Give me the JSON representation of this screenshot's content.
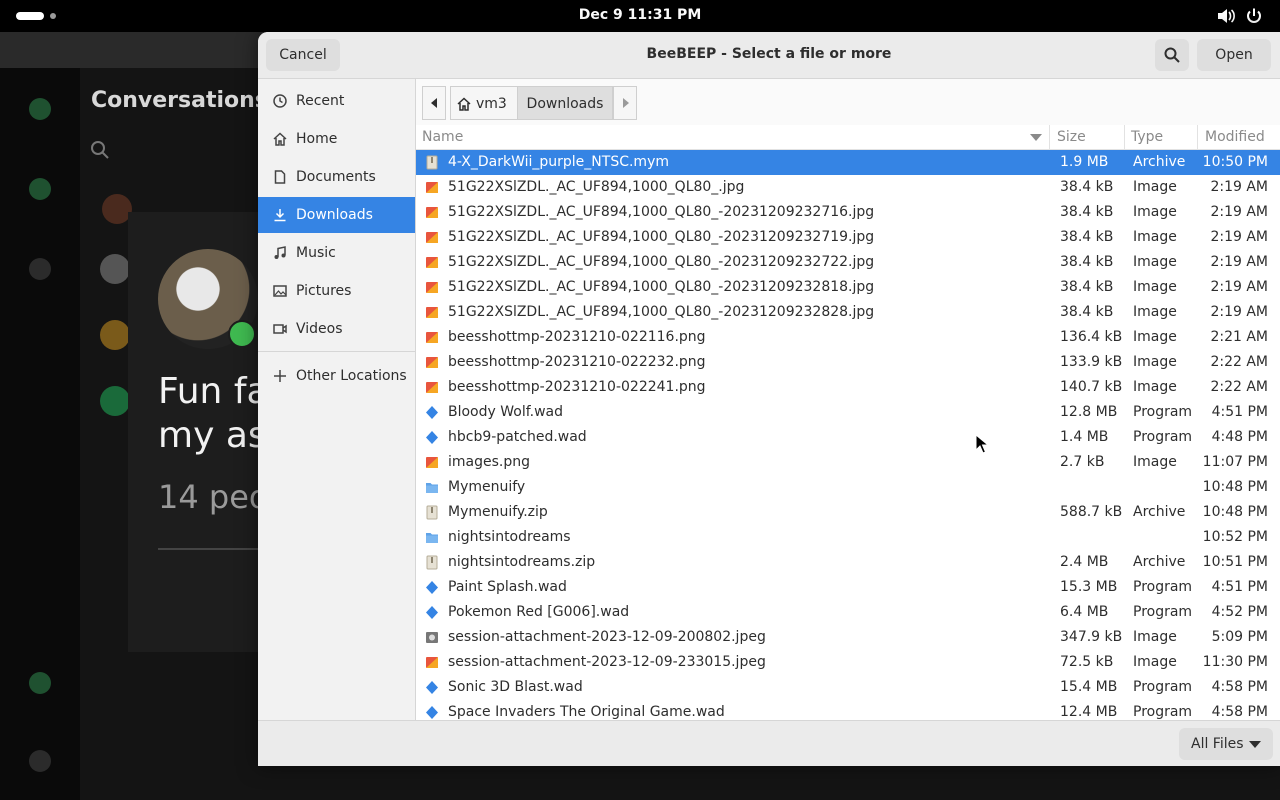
{
  "topbar": {
    "clock": "Dec 9  11:31 PM"
  },
  "background_app": {
    "title": "Conversations",
    "snippet_line1": "Fun fa",
    "snippet_line2": "my as",
    "snippet_count": "14 peo"
  },
  "dialog": {
    "title": "BeeBEEP - Select a file or more",
    "cancel_label": "Cancel",
    "open_label": "Open",
    "filter_label": "All Files"
  },
  "sidebar": {
    "items": [
      {
        "label": "Recent",
        "icon": "clock-icon"
      },
      {
        "label": "Home",
        "icon": "home-icon"
      },
      {
        "label": "Documents",
        "icon": "document-icon"
      },
      {
        "label": "Downloads",
        "icon": "download-icon",
        "active": true
      },
      {
        "label": "Music",
        "icon": "music-icon"
      },
      {
        "label": "Pictures",
        "icon": "picture-icon"
      },
      {
        "label": "Videos",
        "icon": "video-icon"
      }
    ],
    "other_locations": "Other Locations"
  },
  "pathbar": {
    "home_segment": "vm3",
    "current_segment": "Downloads"
  },
  "columns": {
    "name": "Name",
    "size": "Size",
    "type": "Type",
    "modified": "Modified"
  },
  "files": [
    {
      "name": "4-X_DarkWii_purple_NTSC.mym",
      "size": "1.9 MB",
      "type": "Archive",
      "modified": "10:50 PM",
      "kind": "archive",
      "selected": true
    },
    {
      "name": "51G22XSlZDL._AC_UF894,1000_QL80_.jpg",
      "size": "38.4 kB",
      "type": "Image",
      "modified": "2:19 AM",
      "kind": "image"
    },
    {
      "name": "51G22XSlZDL._AC_UF894,1000_QL80_-20231209232716.jpg",
      "size": "38.4 kB",
      "type": "Image",
      "modified": "2:19 AM",
      "kind": "image"
    },
    {
      "name": "51G22XSlZDL._AC_UF894,1000_QL80_-20231209232719.jpg",
      "size": "38.4 kB",
      "type": "Image",
      "modified": "2:19 AM",
      "kind": "image"
    },
    {
      "name": "51G22XSlZDL._AC_UF894,1000_QL80_-20231209232722.jpg",
      "size": "38.4 kB",
      "type": "Image",
      "modified": "2:19 AM",
      "kind": "image"
    },
    {
      "name": "51G22XSlZDL._AC_UF894,1000_QL80_-20231209232818.jpg",
      "size": "38.4 kB",
      "type": "Image",
      "modified": "2:19 AM",
      "kind": "image"
    },
    {
      "name": "51G22XSlZDL._AC_UF894,1000_QL80_-20231209232828.jpg",
      "size": "38.4 kB",
      "type": "Image",
      "modified": "2:19 AM",
      "kind": "image"
    },
    {
      "name": "beesshottmp-20231210-022116.png",
      "size": "136.4 kB",
      "type": "Image",
      "modified": "2:21 AM",
      "kind": "image"
    },
    {
      "name": "beesshottmp-20231210-022232.png",
      "size": "133.9 kB",
      "type": "Image",
      "modified": "2:22 AM",
      "kind": "image"
    },
    {
      "name": "beesshottmp-20231210-022241.png",
      "size": "140.7 kB",
      "type": "Image",
      "modified": "2:22 AM",
      "kind": "image"
    },
    {
      "name": "Bloody Wolf.wad",
      "size": "12.8 MB",
      "type": "Program",
      "modified": "4:51 PM",
      "kind": "program"
    },
    {
      "name": "hbcb9-patched.wad",
      "size": "1.4 MB",
      "type": "Program",
      "modified": "4:48 PM",
      "kind": "program"
    },
    {
      "name": "images.png",
      "size": "2.7 kB",
      "type": "Image",
      "modified": "11:07 PM",
      "kind": "image"
    },
    {
      "name": "Mymenuify",
      "size": "",
      "type": "",
      "modified": "10:48 PM",
      "kind": "folder"
    },
    {
      "name": "Mymenuify.zip",
      "size": "588.7 kB",
      "type": "Archive",
      "modified": "10:48 PM",
      "kind": "archive"
    },
    {
      "name": "nightsintodreams",
      "size": "",
      "type": "",
      "modified": "10:52 PM",
      "kind": "folder"
    },
    {
      "name": "nightsintodreams.zip",
      "size": "2.4 MB",
      "type": "Archive",
      "modified": "10:51 PM",
      "kind": "archive"
    },
    {
      "name": "Paint Splash.wad",
      "size": "15.3 MB",
      "type": "Program",
      "modified": "4:51 PM",
      "kind": "program"
    },
    {
      "name": "Pokemon Red [G006].wad",
      "size": "6.4 MB",
      "type": "Program",
      "modified": "4:52 PM",
      "kind": "program"
    },
    {
      "name": "session-attachment-2023-12-09-200802.jpeg",
      "size": "347.9 kB",
      "type": "Image",
      "modified": "5:09 PM",
      "kind": "photo"
    },
    {
      "name": "session-attachment-2023-12-09-233015.jpeg",
      "size": "72.5 kB",
      "type": "Image",
      "modified": "11:30 PM",
      "kind": "image"
    },
    {
      "name": "Sonic 3D Blast.wad",
      "size": "15.4 MB",
      "type": "Program",
      "modified": "4:58 PM",
      "kind": "program"
    },
    {
      "name": "Space Invaders The Original Game.wad",
      "size": "12.4 MB",
      "type": "Program",
      "modified": "4:58 PM",
      "kind": "program"
    }
  ],
  "colors": {
    "accent": "#3584e4",
    "header_bg": "#ebebeb"
  }
}
